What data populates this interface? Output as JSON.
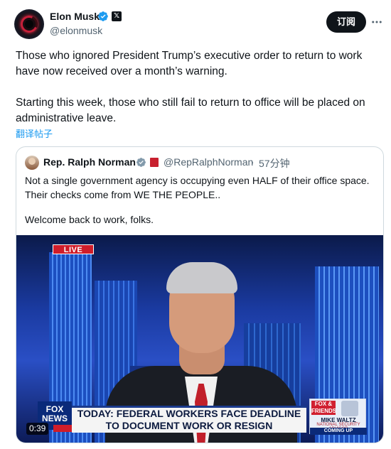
{
  "author": {
    "name": "Elon Musk",
    "handle": "@elonmusk",
    "verified_badge_icon": "verified-badge-icon",
    "affiliate_badge": "𝕏"
  },
  "header": {
    "subscribe_label": "订阅",
    "more_icon": "more-icon"
  },
  "tweet": {
    "paragraph1": "Those who ignored President Trump’s executive order to return to work have now received over a month’s warning.",
    "paragraph2": "Starting this week, those who still fail to return to office will be placed on administrative leave.",
    "translate_label": "翻译帖子"
  },
  "quoted_tweet": {
    "name": "Rep. Ralph Norman",
    "handle": "@RepRalphNorman",
    "separator": "·",
    "time": "57分钟",
    "line1": "Not a single government agency is occupying even HALF of their office space.",
    "line2": "Their checks come from WE THE PEOPLE..",
    "line3": "Welcome back to work, folks."
  },
  "video": {
    "live_label": "LIVE",
    "duration": "0:39",
    "channel_logo": "FOX NEWS",
    "chyron_line1": "TODAY: FEDERAL WORKERS FACE DEADLINE",
    "chyron_line2": "TO DOCUMENT WORK OR RESIGN",
    "promo_logo": "FOX & FRIENDS",
    "promo_name": "MIKE WALTZ",
    "promo_role": "NATIONAL SECURITY ADVISOR",
    "promo_coming": "COMING UP"
  },
  "colors": {
    "accent": "#1d9bf0",
    "text_primary": "#0f1419",
    "text_secondary": "#536471",
    "border": "#cfd9de",
    "live_red": "#d01d2a"
  }
}
